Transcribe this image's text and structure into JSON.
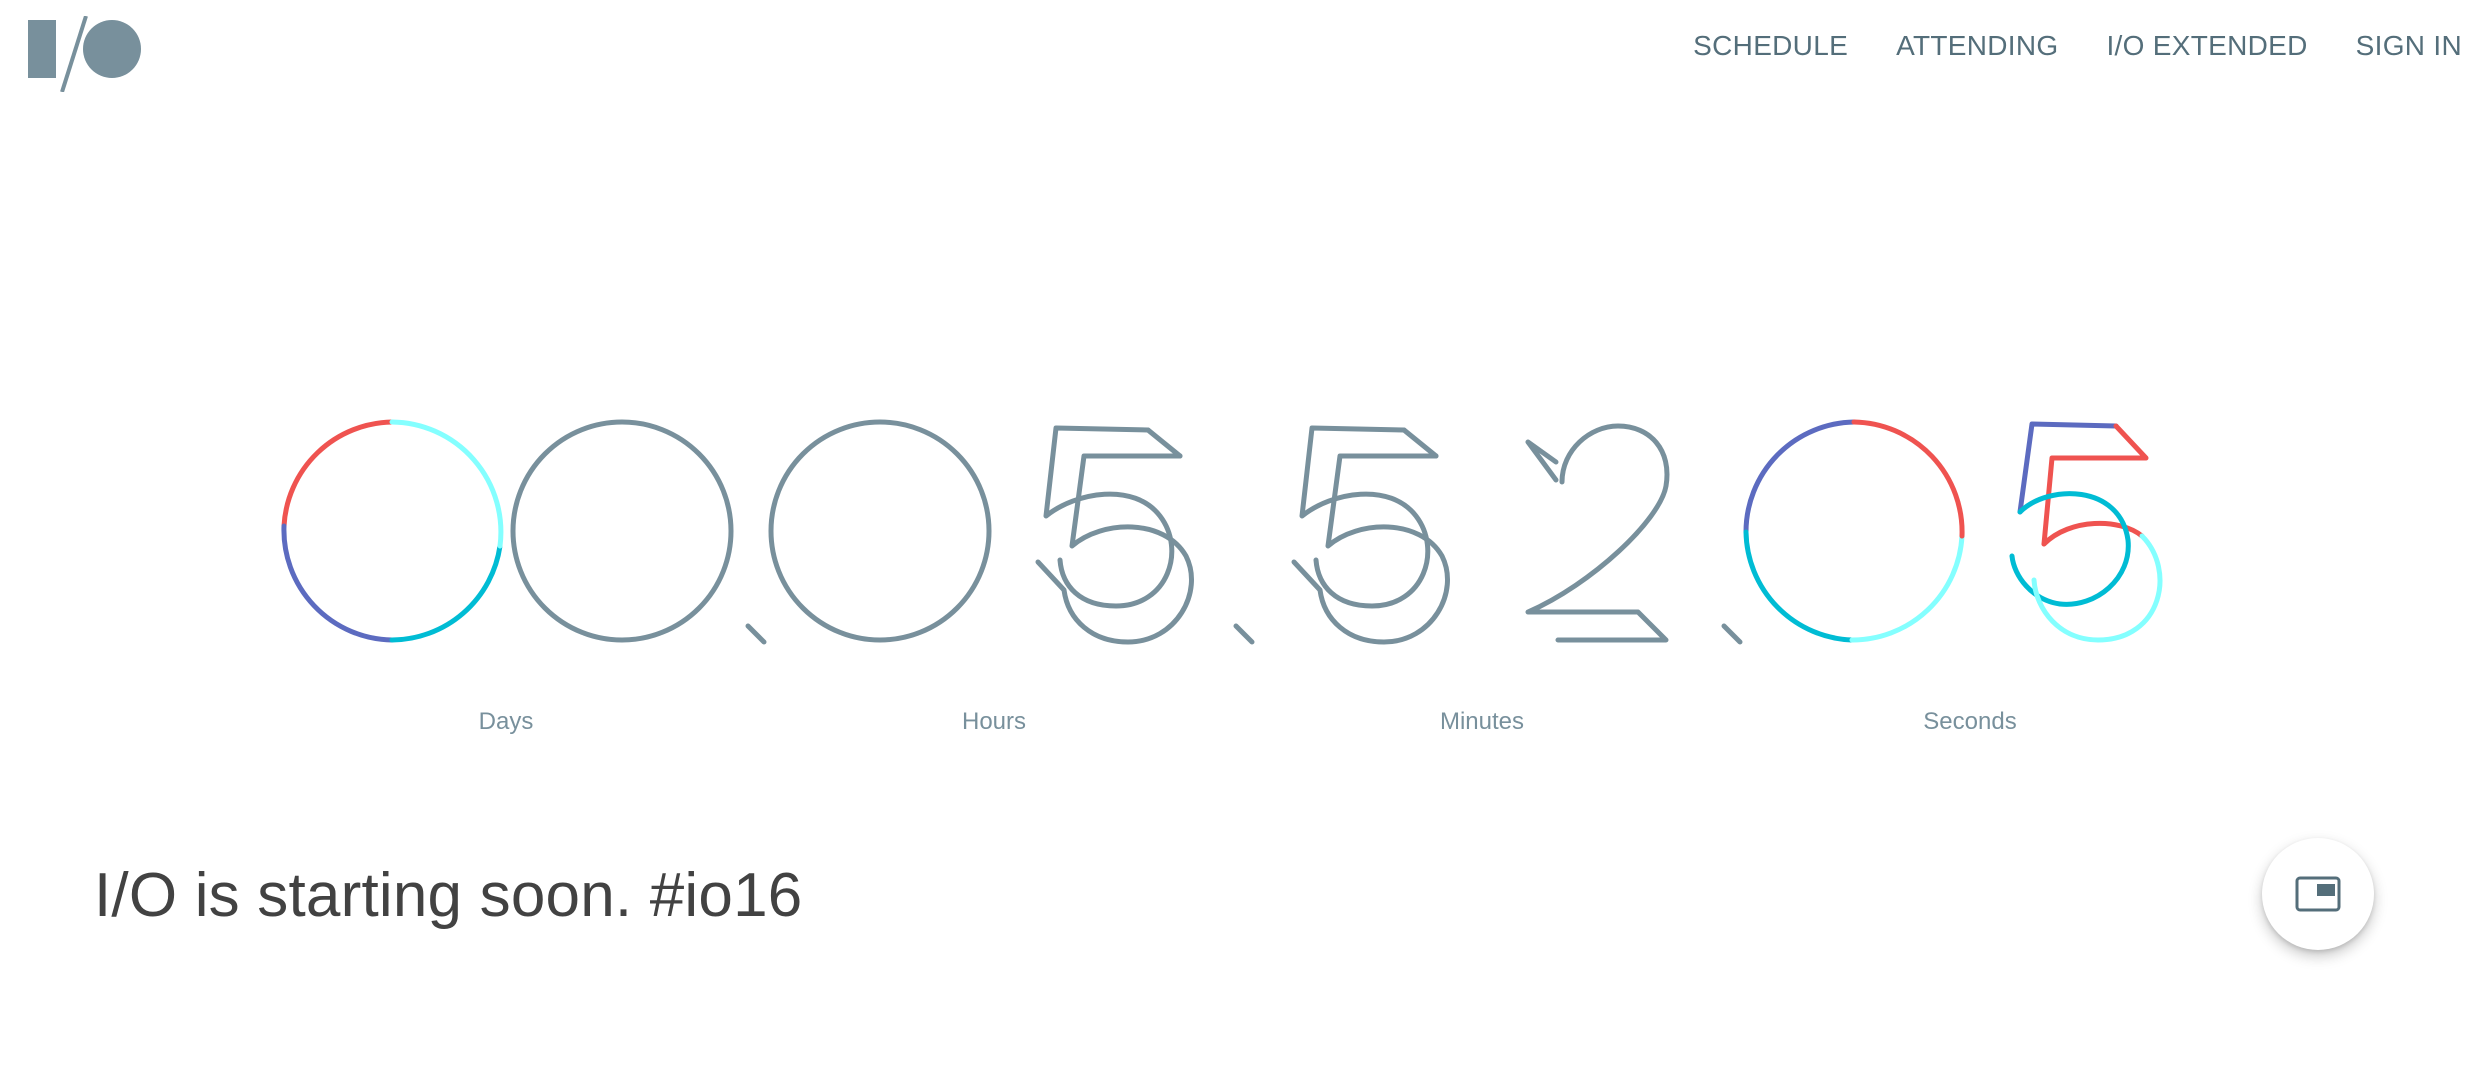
{
  "header": {
    "logo_alt": "I/O",
    "nav": [
      {
        "label": "SCHEDULE"
      },
      {
        "label": "ATTENDING"
      },
      {
        "label": "I/O EXTENDED"
      },
      {
        "label": "SIGN IN"
      }
    ]
  },
  "countdown": {
    "digits": {
      "days": "00",
      "hours": "05",
      "minutes": "52",
      "seconds": "05"
    },
    "labels": {
      "days": "Days",
      "hours": "Hours",
      "minutes": "Minutes",
      "seconds": "Seconds"
    }
  },
  "main": {
    "tagline": "I/O is starting soon. #io16"
  },
  "fab": {
    "icon": "picture-in-picture-icon"
  },
  "colors": {
    "gray": "#78909c",
    "nav": "#546e7a",
    "red": "#ef5350",
    "cyan": "#00bcd4",
    "light_cyan": "#84ffff",
    "indigo": "#5c6bc0"
  }
}
